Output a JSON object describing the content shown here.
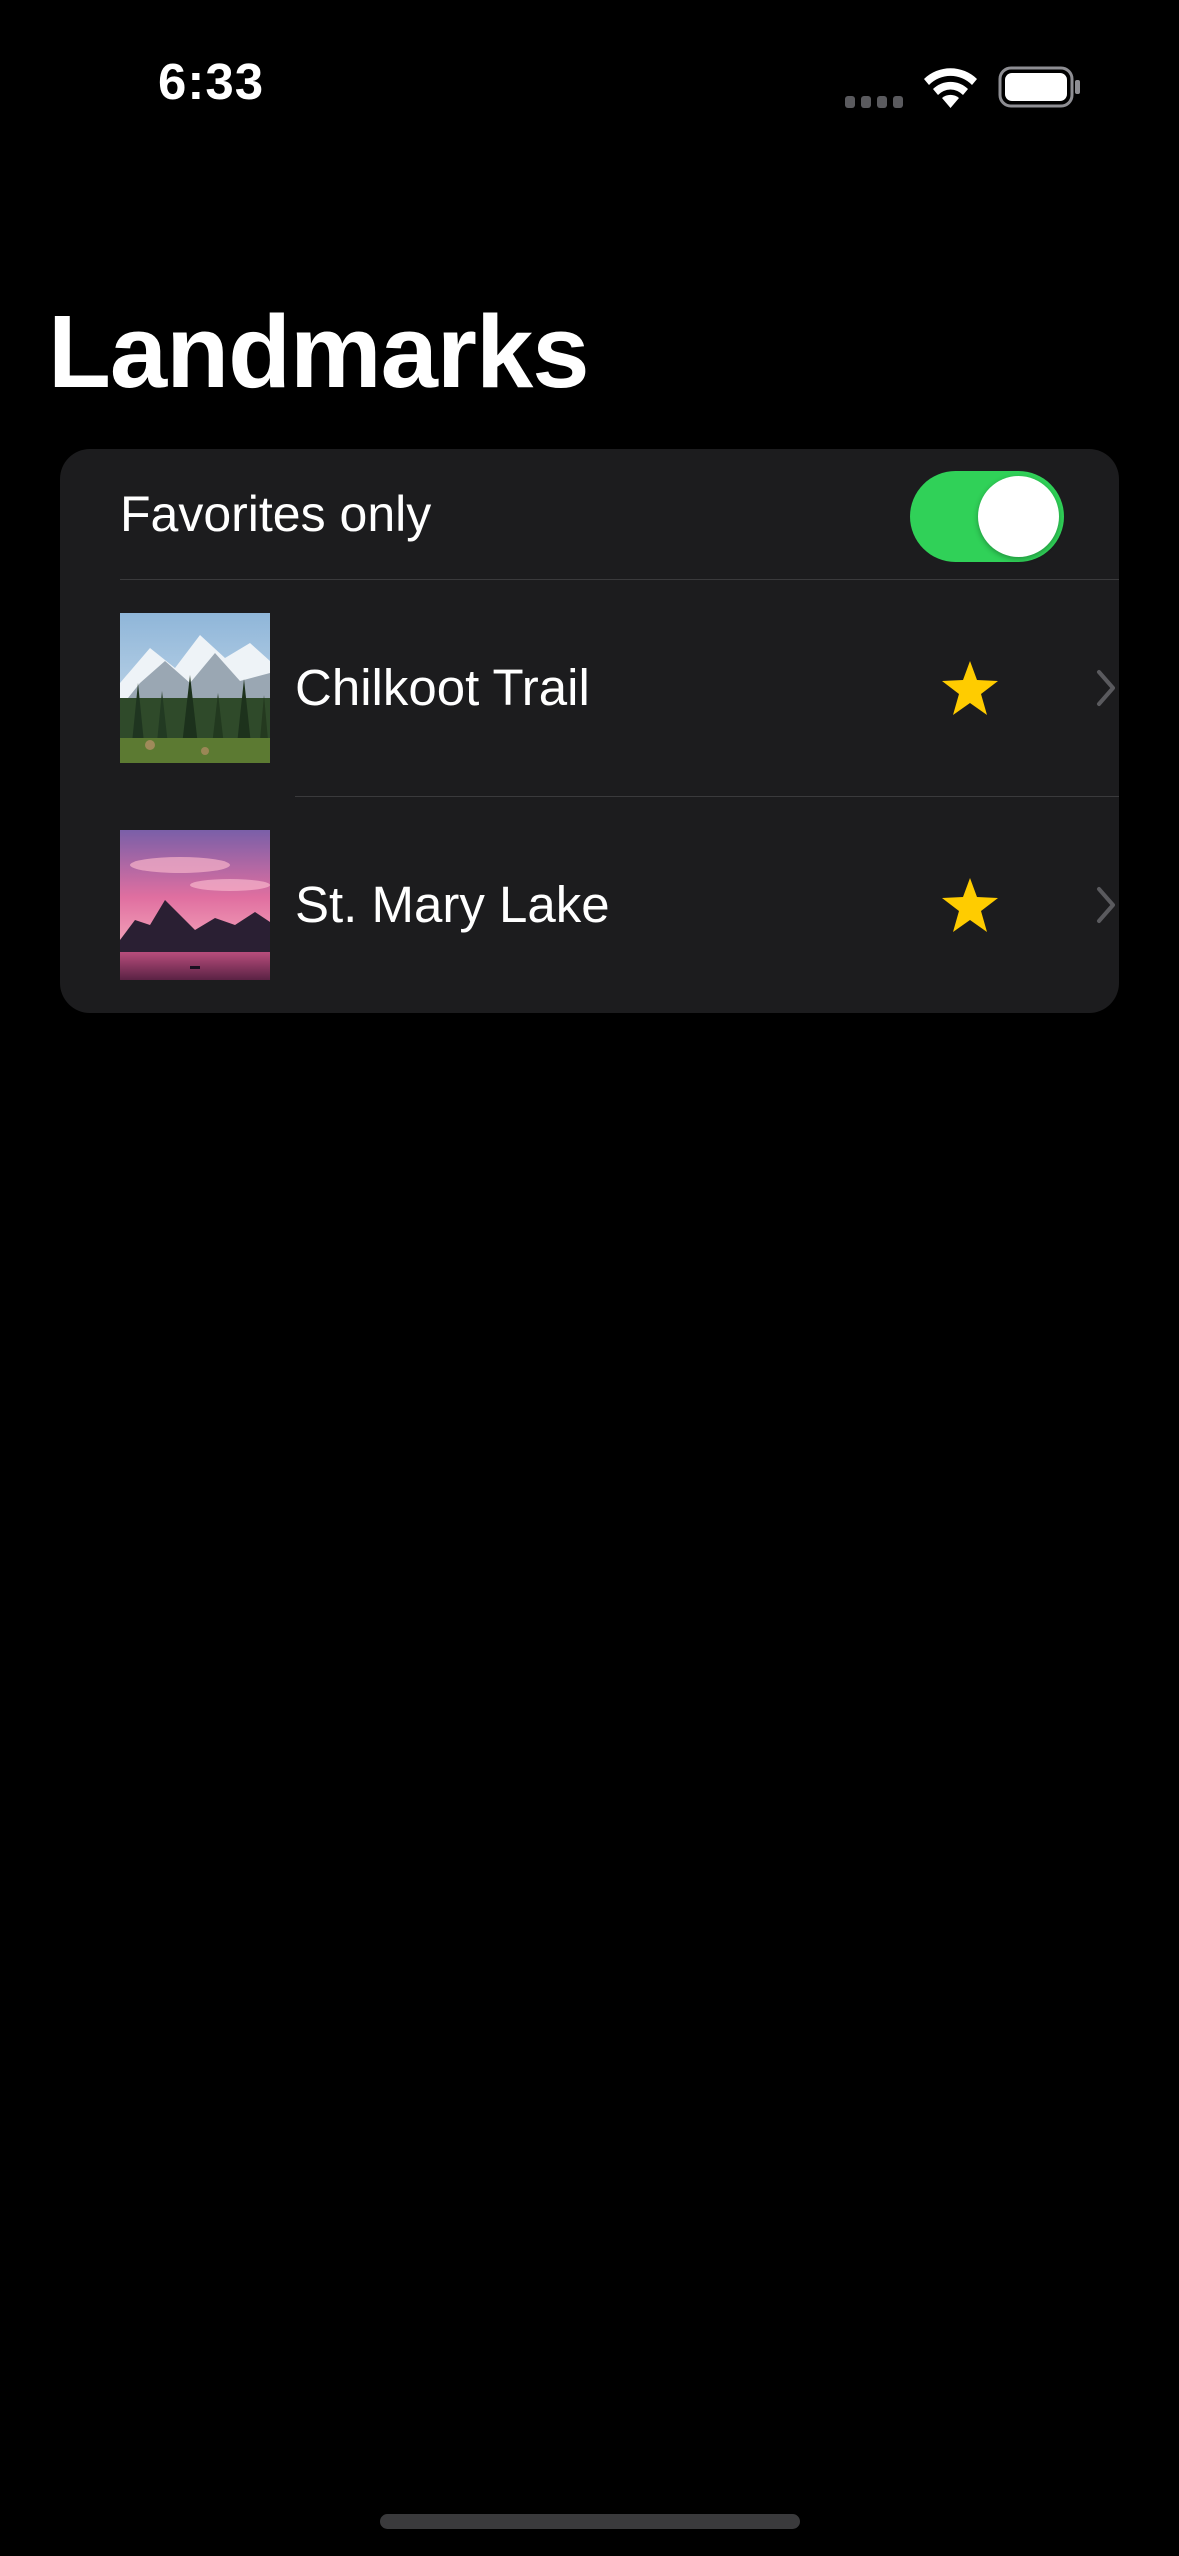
{
  "status_bar": {
    "time": "6:33",
    "signal_icon": "cellular-signal-icon",
    "wifi_icon": "wifi-icon",
    "battery_icon": "battery-icon"
  },
  "title": "Landmarks",
  "favorites_toggle": {
    "label": "Favorites only",
    "on": true,
    "color": "#30d158"
  },
  "landmarks": [
    {
      "name": "Chilkoot Trail",
      "favorite": true,
      "thumbnail": "mountain-forest-photo"
    },
    {
      "name": "St. Mary Lake",
      "favorite": true,
      "thumbnail": "sunset-lake-photo"
    }
  ],
  "colors": {
    "background": "#000000",
    "card": "#1c1c1e",
    "star": "#ffcc00",
    "separator": "#3a3a3c"
  }
}
